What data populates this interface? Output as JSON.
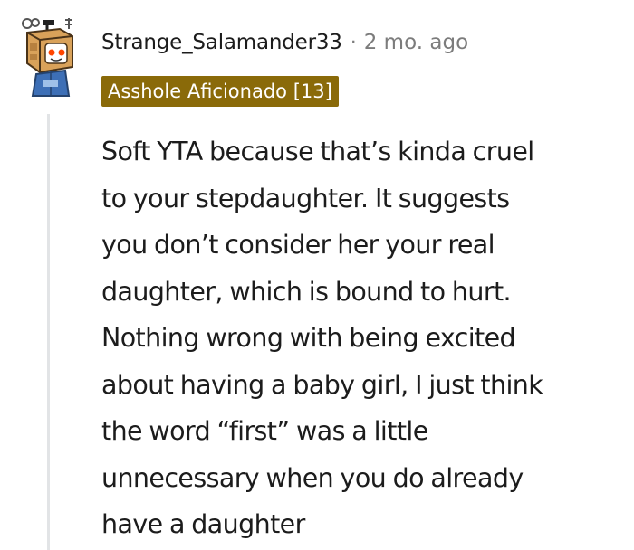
{
  "comment": {
    "username": "Strange_Salamander33",
    "separator": "·",
    "timestamp": "2 mo. ago",
    "flair": "Asshole Aficionado [13]",
    "flair_color": "#8a6a09",
    "avatar_icon": "robot-box-avatar",
    "body_lines": [
      "Soft YTA because that’s kinda cruel",
      "to your stepdaughter. It suggests",
      "you don’t consider her your real",
      "daughter, which is bound to hurt.",
      "Nothing wrong with being excited",
      "about having a baby girl, I just think",
      "the word “first” was a little",
      "unnecessary when you do already",
      "have a daughter"
    ]
  }
}
